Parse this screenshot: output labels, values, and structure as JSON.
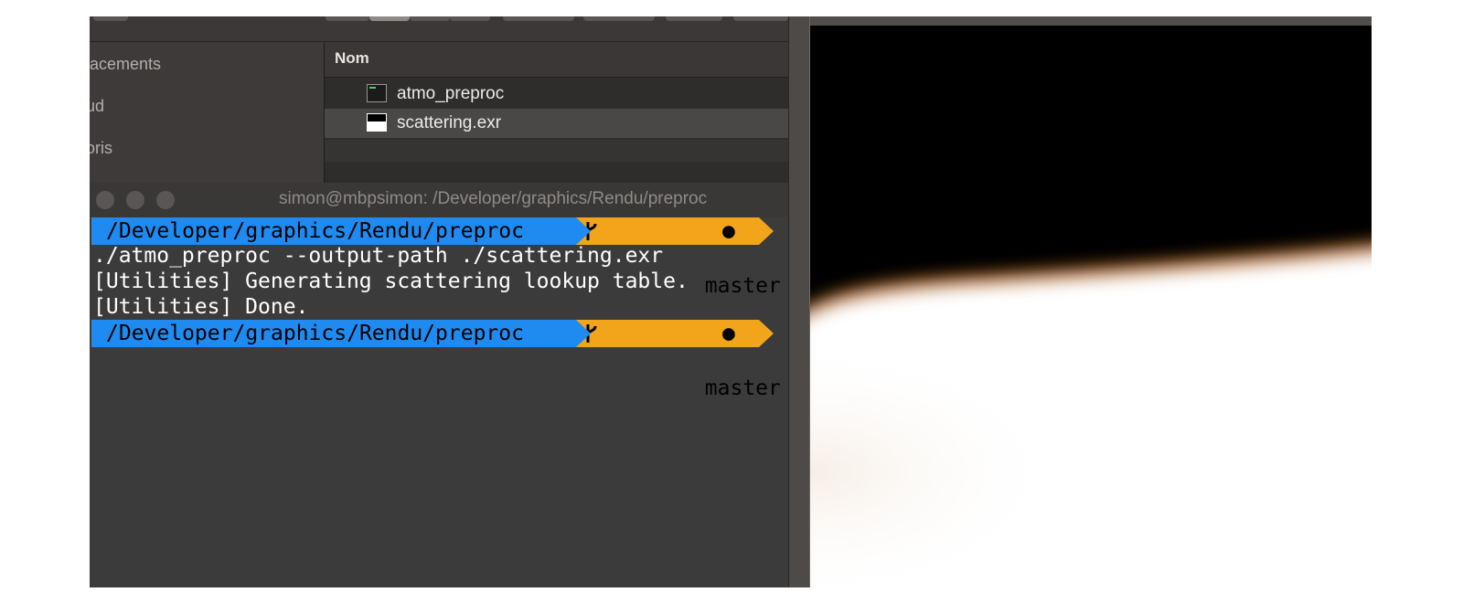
{
  "finder": {
    "sidebar_items": [
      "lacements",
      "ud",
      "oris"
    ],
    "column_header": "Nom",
    "files": [
      {
        "name": "atmo_preproc",
        "icon": "terminal-executable-icon"
      },
      {
        "name": "scattering.exr",
        "icon": "exr-image-icon"
      }
    ]
  },
  "terminal": {
    "title": "simon@mbpsimon: /Developer/graphics/Rendu/preproc",
    "prompt_path": "/Developer/graphics/Rendu/preproc",
    "branch_icon": "git-branch-icon",
    "branch": "master",
    "dirty_marker": "●",
    "lines": [
      "./atmo_preproc --output-path ./scattering.exr",
      "[Utilities] Generating scattering lookup table.",
      "[Utilities] Done."
    ]
  },
  "colors": {
    "prompt_path_bg": "#1f8bf0",
    "prompt_branch_bg": "#f2a51a",
    "terminal_bg": "#3b3b3b",
    "scattering_glow": "#a34f10"
  }
}
